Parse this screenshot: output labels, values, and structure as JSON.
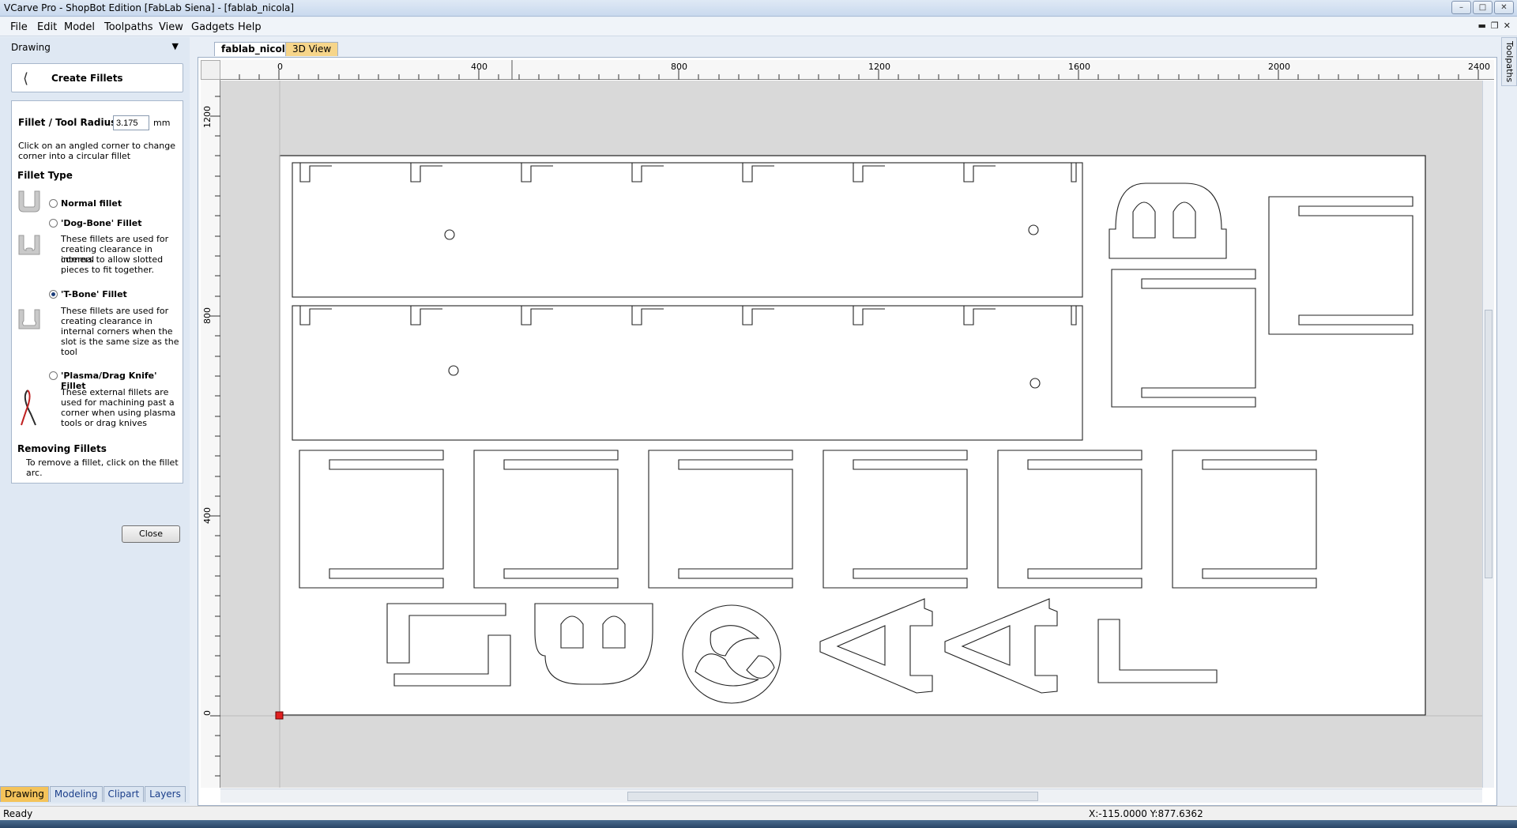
{
  "window": {
    "title": "VCarve Pro - ShopBot Edition [FabLab Siena] - [fablab_nicola]",
    "min_icon": "minimize-icon",
    "max_icon": "maximize-icon",
    "close_icon": "close-icon"
  },
  "menu": [
    "File",
    "Edit",
    "Model",
    "Toolpaths",
    "View",
    "Gadgets",
    "Help"
  ],
  "panel": {
    "title": "Drawing",
    "tool_title": "Create Fillets",
    "radius_label": "Fillet / Tool Radius:",
    "radius_value": "3.175",
    "radius_unit": "mm",
    "intro_line1": "Click on an angled corner to change",
    "intro_line2": "corner into a circular fillet",
    "fillet_type_heading": "Fillet Type",
    "normal_label": "Normal fillet",
    "dogbone_label": "'Dog-Bone' Fillet",
    "dogbone_desc": [
      "These fillets are used for",
      "creating clearance in internal",
      "corners to allow slotted",
      "pieces to fit together."
    ],
    "tbone_label": "'T-Bone' Fillet",
    "tbone_desc": [
      "These fillets are used for",
      "creating clearance in",
      "internal corners when the",
      "slot is the same size as the",
      "tool"
    ],
    "plasma_label": "'Plasma/Drag Knife' Fillet",
    "plasma_desc": [
      "These external fillets are",
      "used for machining past a",
      "corner when using plasma",
      "tools or drag knives"
    ],
    "removing_heading": "Removing Fillets",
    "removing_desc": "To remove a fillet, click on the fillet arc.",
    "close_label": "Close",
    "selected_type": "tbone"
  },
  "bottom_tabs": [
    "Drawing",
    "Modeling",
    "Clipart",
    "Layers"
  ],
  "doc_tabs": [
    "fablab_nicola",
    "3D View"
  ],
  "right_dock_label": "Toolpaths",
  "ruler": {
    "top_labels": [
      "0",
      "400",
      "800",
      "1200",
      "1600",
      "2000",
      "2400"
    ],
    "left_labels": [
      "1200",
      "800",
      "400",
      "0"
    ]
  },
  "status": {
    "ready": "Ready",
    "coords": "X:-115.0000 Y:877.6362"
  }
}
